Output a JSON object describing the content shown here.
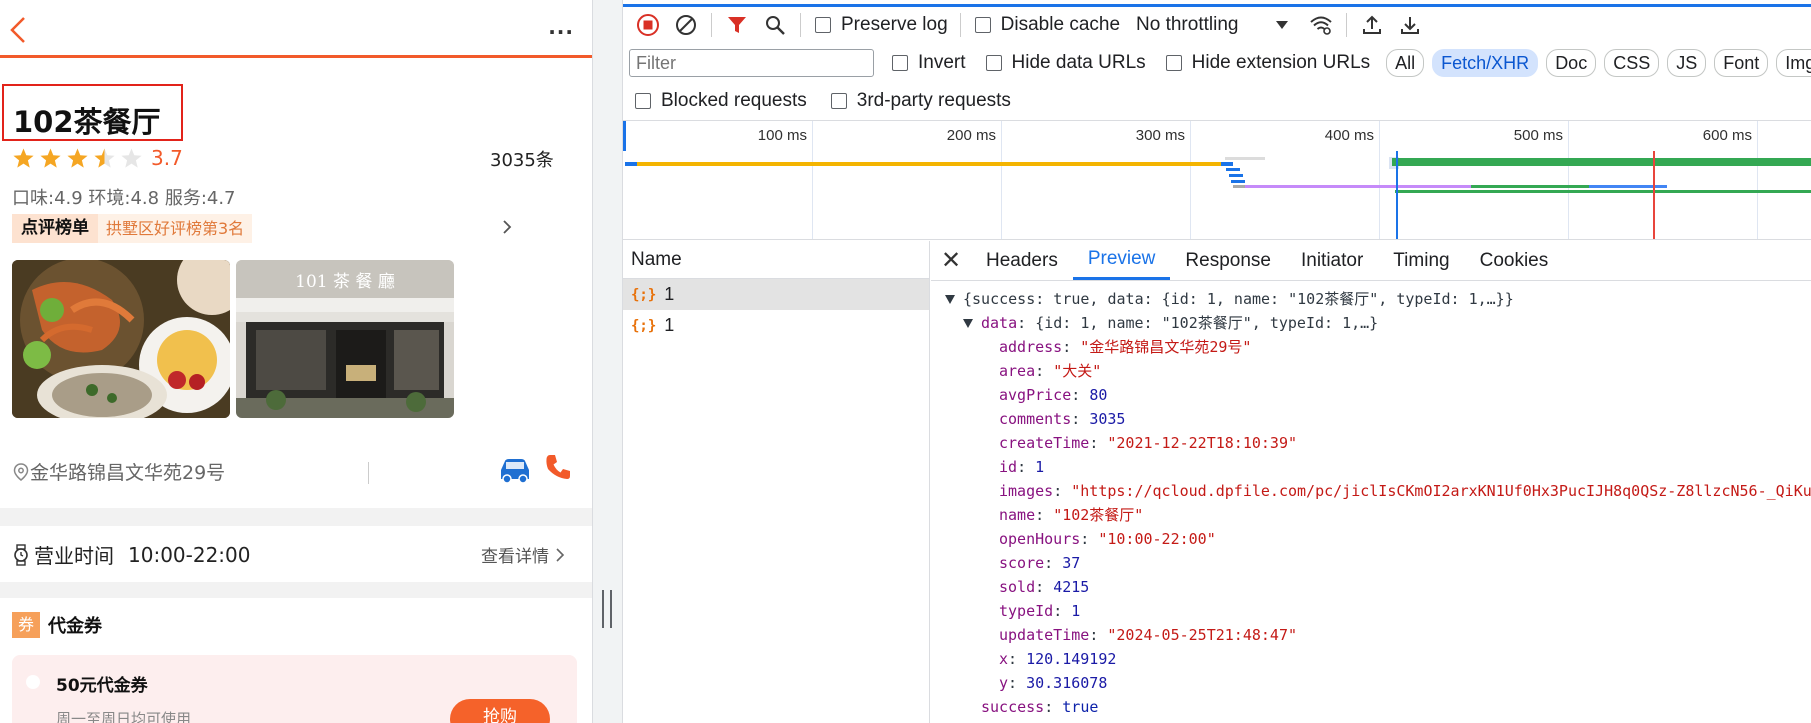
{
  "mobile": {
    "shop_name": "102茶餐厅",
    "rating": "3.7",
    "stars": [
      1,
      1,
      1,
      0.5,
      0
    ],
    "comment_count": "3035条",
    "sub_scores": "口味:4.9 环境:4.8 服务:4.7",
    "rank_label": "点评榜单",
    "rank_text": "拱墅区好评榜第3名",
    "store_sign": "101 茶 餐 廳",
    "address": "金华路锦昌文华苑29号",
    "hours_label": "营业时间",
    "hours_value": "10:00-22:00",
    "hours_detail": "查看详情",
    "coupon_tag": "券",
    "coupon_title": "代金券",
    "coupon_name": "50元代金券",
    "coupon_desc": "周一至周日均可使用",
    "buy_label": "抢购",
    "more_label": "···",
    "accent_color": "#f25a2a"
  },
  "devtools": {
    "toolbar": {
      "preserve_log": "Preserve log",
      "disable_cache": "Disable cache",
      "throttling": "No throttling"
    },
    "filter": {
      "placeholder": "Filter",
      "invert": "Invert",
      "hide_data_urls": "Hide data URLs",
      "hide_extension_urls": "Hide extension URLs",
      "types": [
        "All",
        "Fetch/XHR",
        "Doc",
        "CSS",
        "JS",
        "Font",
        "Img"
      ],
      "active_type": "Fetch/XHR"
    },
    "options": {
      "blocked_requests": "Blocked requests",
      "third_party": "3rd-party requests"
    },
    "timeline": {
      "ticks": [
        "100 ms",
        "200 ms",
        "300 ms",
        "400 ms",
        "500 ms",
        "600 ms"
      ]
    },
    "requests": {
      "header": "Name",
      "items": [
        {
          "name": "1",
          "selected": true
        },
        {
          "name": "1",
          "selected": false
        }
      ]
    },
    "detail_tabs": [
      "Headers",
      "Preview",
      "Response",
      "Initiator",
      "Timing",
      "Cookies"
    ],
    "active_detail_tab": "Preview",
    "preview": {
      "root_summary": "{success: true, data: {id: 1, name: \"102茶餐厅\", typeId: 1,…}}",
      "data_summary": "{id: 1, name: \"102茶餐厅\", typeId: 1,…}",
      "fields": [
        {
          "key": "address",
          "value": "\"金华路锦昌文华苑29号\"",
          "kind": "str"
        },
        {
          "key": "area",
          "value": "\"大关\"",
          "kind": "str"
        },
        {
          "key": "avgPrice",
          "value": "80",
          "kind": "num"
        },
        {
          "key": "comments",
          "value": "3035",
          "kind": "num"
        },
        {
          "key": "createTime",
          "value": "\"2021-12-22T18:10:39\"",
          "kind": "str"
        },
        {
          "key": "id",
          "value": "1",
          "kind": "num"
        },
        {
          "key": "images",
          "value": "\"https://qcloud.dpfile.com/pc/jiclIsCKmOI2arxKN1Uf0Hx3PucIJH8q0QSz-Z8llzcN56-_QiKu",
          "kind": "str"
        },
        {
          "key": "name",
          "value": "\"102茶餐厅\"",
          "kind": "str"
        },
        {
          "key": "openHours",
          "value": "\"10:00-22:00\"",
          "kind": "str"
        },
        {
          "key": "score",
          "value": "37",
          "kind": "num"
        },
        {
          "key": "sold",
          "value": "4215",
          "kind": "num"
        },
        {
          "key": "typeId",
          "value": "1",
          "kind": "num"
        },
        {
          "key": "updateTime",
          "value": "\"2024-05-25T21:48:47\"",
          "kind": "str"
        },
        {
          "key": "x",
          "value": "120.149192",
          "kind": "num"
        },
        {
          "key": "y",
          "value": "30.316078",
          "kind": "num"
        }
      ],
      "success_key": "success",
      "success_value": "true"
    }
  }
}
